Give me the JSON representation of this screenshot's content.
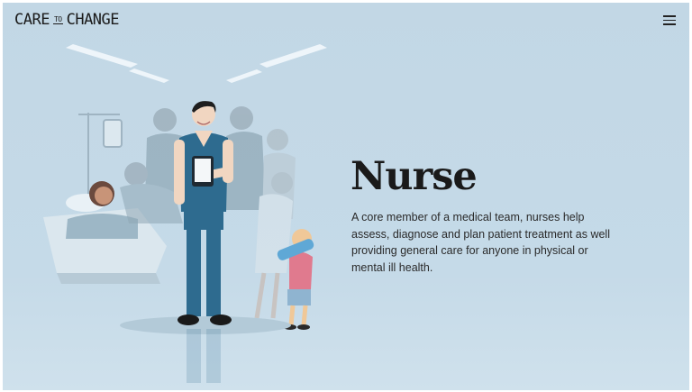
{
  "brand": {
    "logo_left": "CARE",
    "logo_mid": "TO",
    "logo_right": "CHANGE"
  },
  "header": {
    "menu_icon": "hamburger-menu-icon"
  },
  "role": {
    "title": "Nurse",
    "description": "A core member of a medical team, nurses help assess, diagnose and plan patient treatment as well providing general care for anyone in physical or mental ill health."
  },
  "colors": {
    "background": "#c4d9e7",
    "scrubs": "#2e6b8f",
    "text": "#1a1a1a"
  }
}
